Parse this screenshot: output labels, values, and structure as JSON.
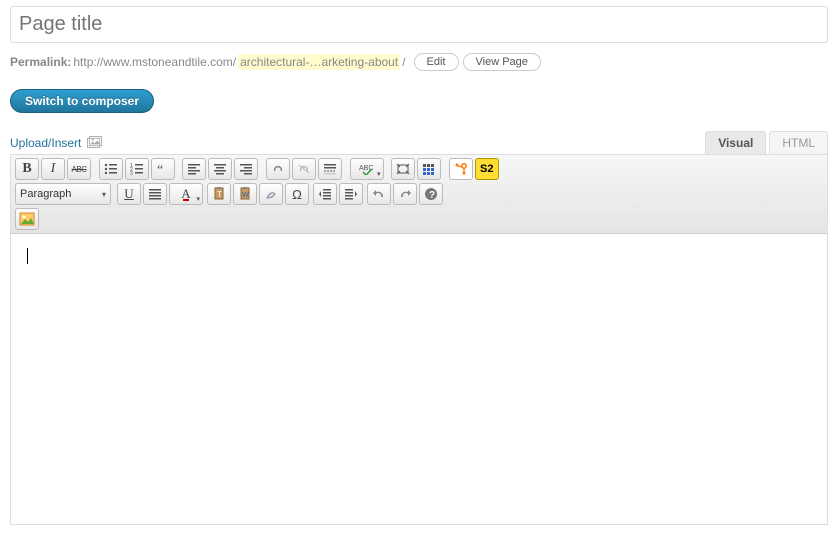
{
  "title": {
    "placeholder": "Page title"
  },
  "permalink": {
    "label": "Permalink:",
    "base": "http://www.mstoneandtile.com/",
    "slug": "architectural-…arketing-about",
    "slash": "/",
    "edit": "Edit",
    "view": "View Page"
  },
  "composer_btn": "Switch to composer",
  "upload": {
    "label": "Upload/Insert"
  },
  "tabs": {
    "visual": "Visual",
    "html": "HTML"
  },
  "toolbar": {
    "bold": "B",
    "italic": "I",
    "strike": "ABC",
    "underline": "U",
    "textcolor": "A",
    "paragraph": "Paragraph",
    "omega": "Ω",
    "question": "?",
    "s2": "S2"
  }
}
